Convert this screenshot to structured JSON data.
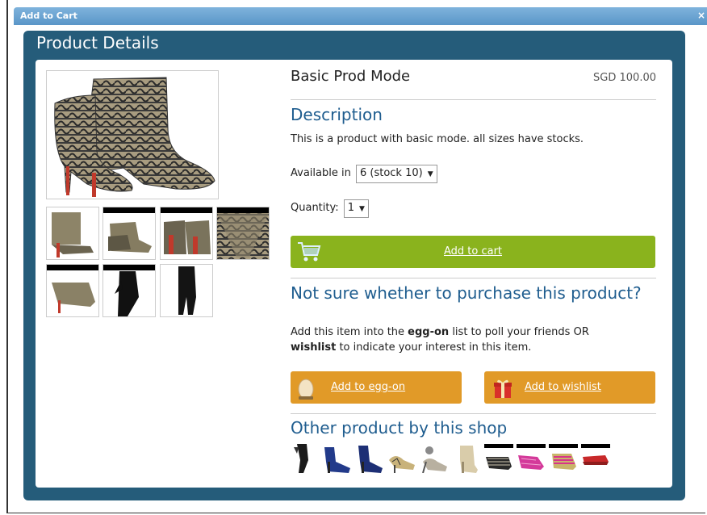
{
  "window": {
    "title": "Add to Cart",
    "close_glyph": "×"
  },
  "panel": {
    "title": "Product Details"
  },
  "product": {
    "name": "Basic Prod Mode",
    "price": "SGD 100.00",
    "description_heading": "Description",
    "description": "This is a product with basic mode. all sizes have stocks.",
    "availability_label": "Available in",
    "availability_value": "6 (stock 10)",
    "quantity_label": "Quantity:",
    "quantity_value": "1"
  },
  "actions": {
    "add_to_cart": "Add to cart",
    "add_to_eggon": "Add to egg-on",
    "add_to_wishlist": "Add to wishlist"
  },
  "unsure": {
    "heading": "Not sure whether to purchase this product?",
    "text_1": "Add this item into the ",
    "text_bold_1": "egg-on",
    "text_2": " list to poll your friends OR",
    "text_bold_2": "wishlist",
    "text_3": " to indicate your interest in this item."
  },
  "other": {
    "heading": "Other product by this shop"
  },
  "icons": {
    "cart": "cart-icon",
    "egg": "egg-icon",
    "gift": "gift-icon",
    "caret": "chevron-down-icon"
  },
  "colors": {
    "panel": "#255c7a",
    "accent_text": "#1f5d8f",
    "green_button": "#8ab31d",
    "orange_button": "#e19a28",
    "titlebar": "#6ca6d4"
  }
}
